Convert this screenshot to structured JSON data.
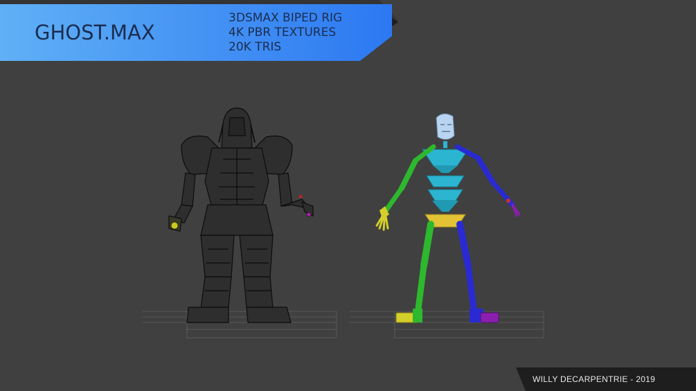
{
  "banner": {
    "title": "GHOST.MAX",
    "specs": [
      "3DSMAX BIPED RIG",
      "4K PBR TEXTURES",
      "20K TRIS"
    ],
    "colors": {
      "gradient_start": "#5aa8f4",
      "gradient_end": "#2f7bf2",
      "text": "#1b2d4f"
    }
  },
  "credit": {
    "text": "WILLY DECARPENTRIE - 2019"
  },
  "scene": {
    "background": "#404040",
    "models": [
      {
        "name": "wireframe-armored-character",
        "style": "black wireframe mesh"
      },
      {
        "name": "biped-skeleton-rig",
        "colors": {
          "head": "#b8d4f0",
          "spine": "#2cb5d0",
          "pelvis": "#e3c236",
          "left-side": "#2db82d",
          "right-side": "#2a2ad2",
          "left-foot": "#d4cf2a",
          "right-foot": "#8a1fb0"
        }
      }
    ]
  }
}
